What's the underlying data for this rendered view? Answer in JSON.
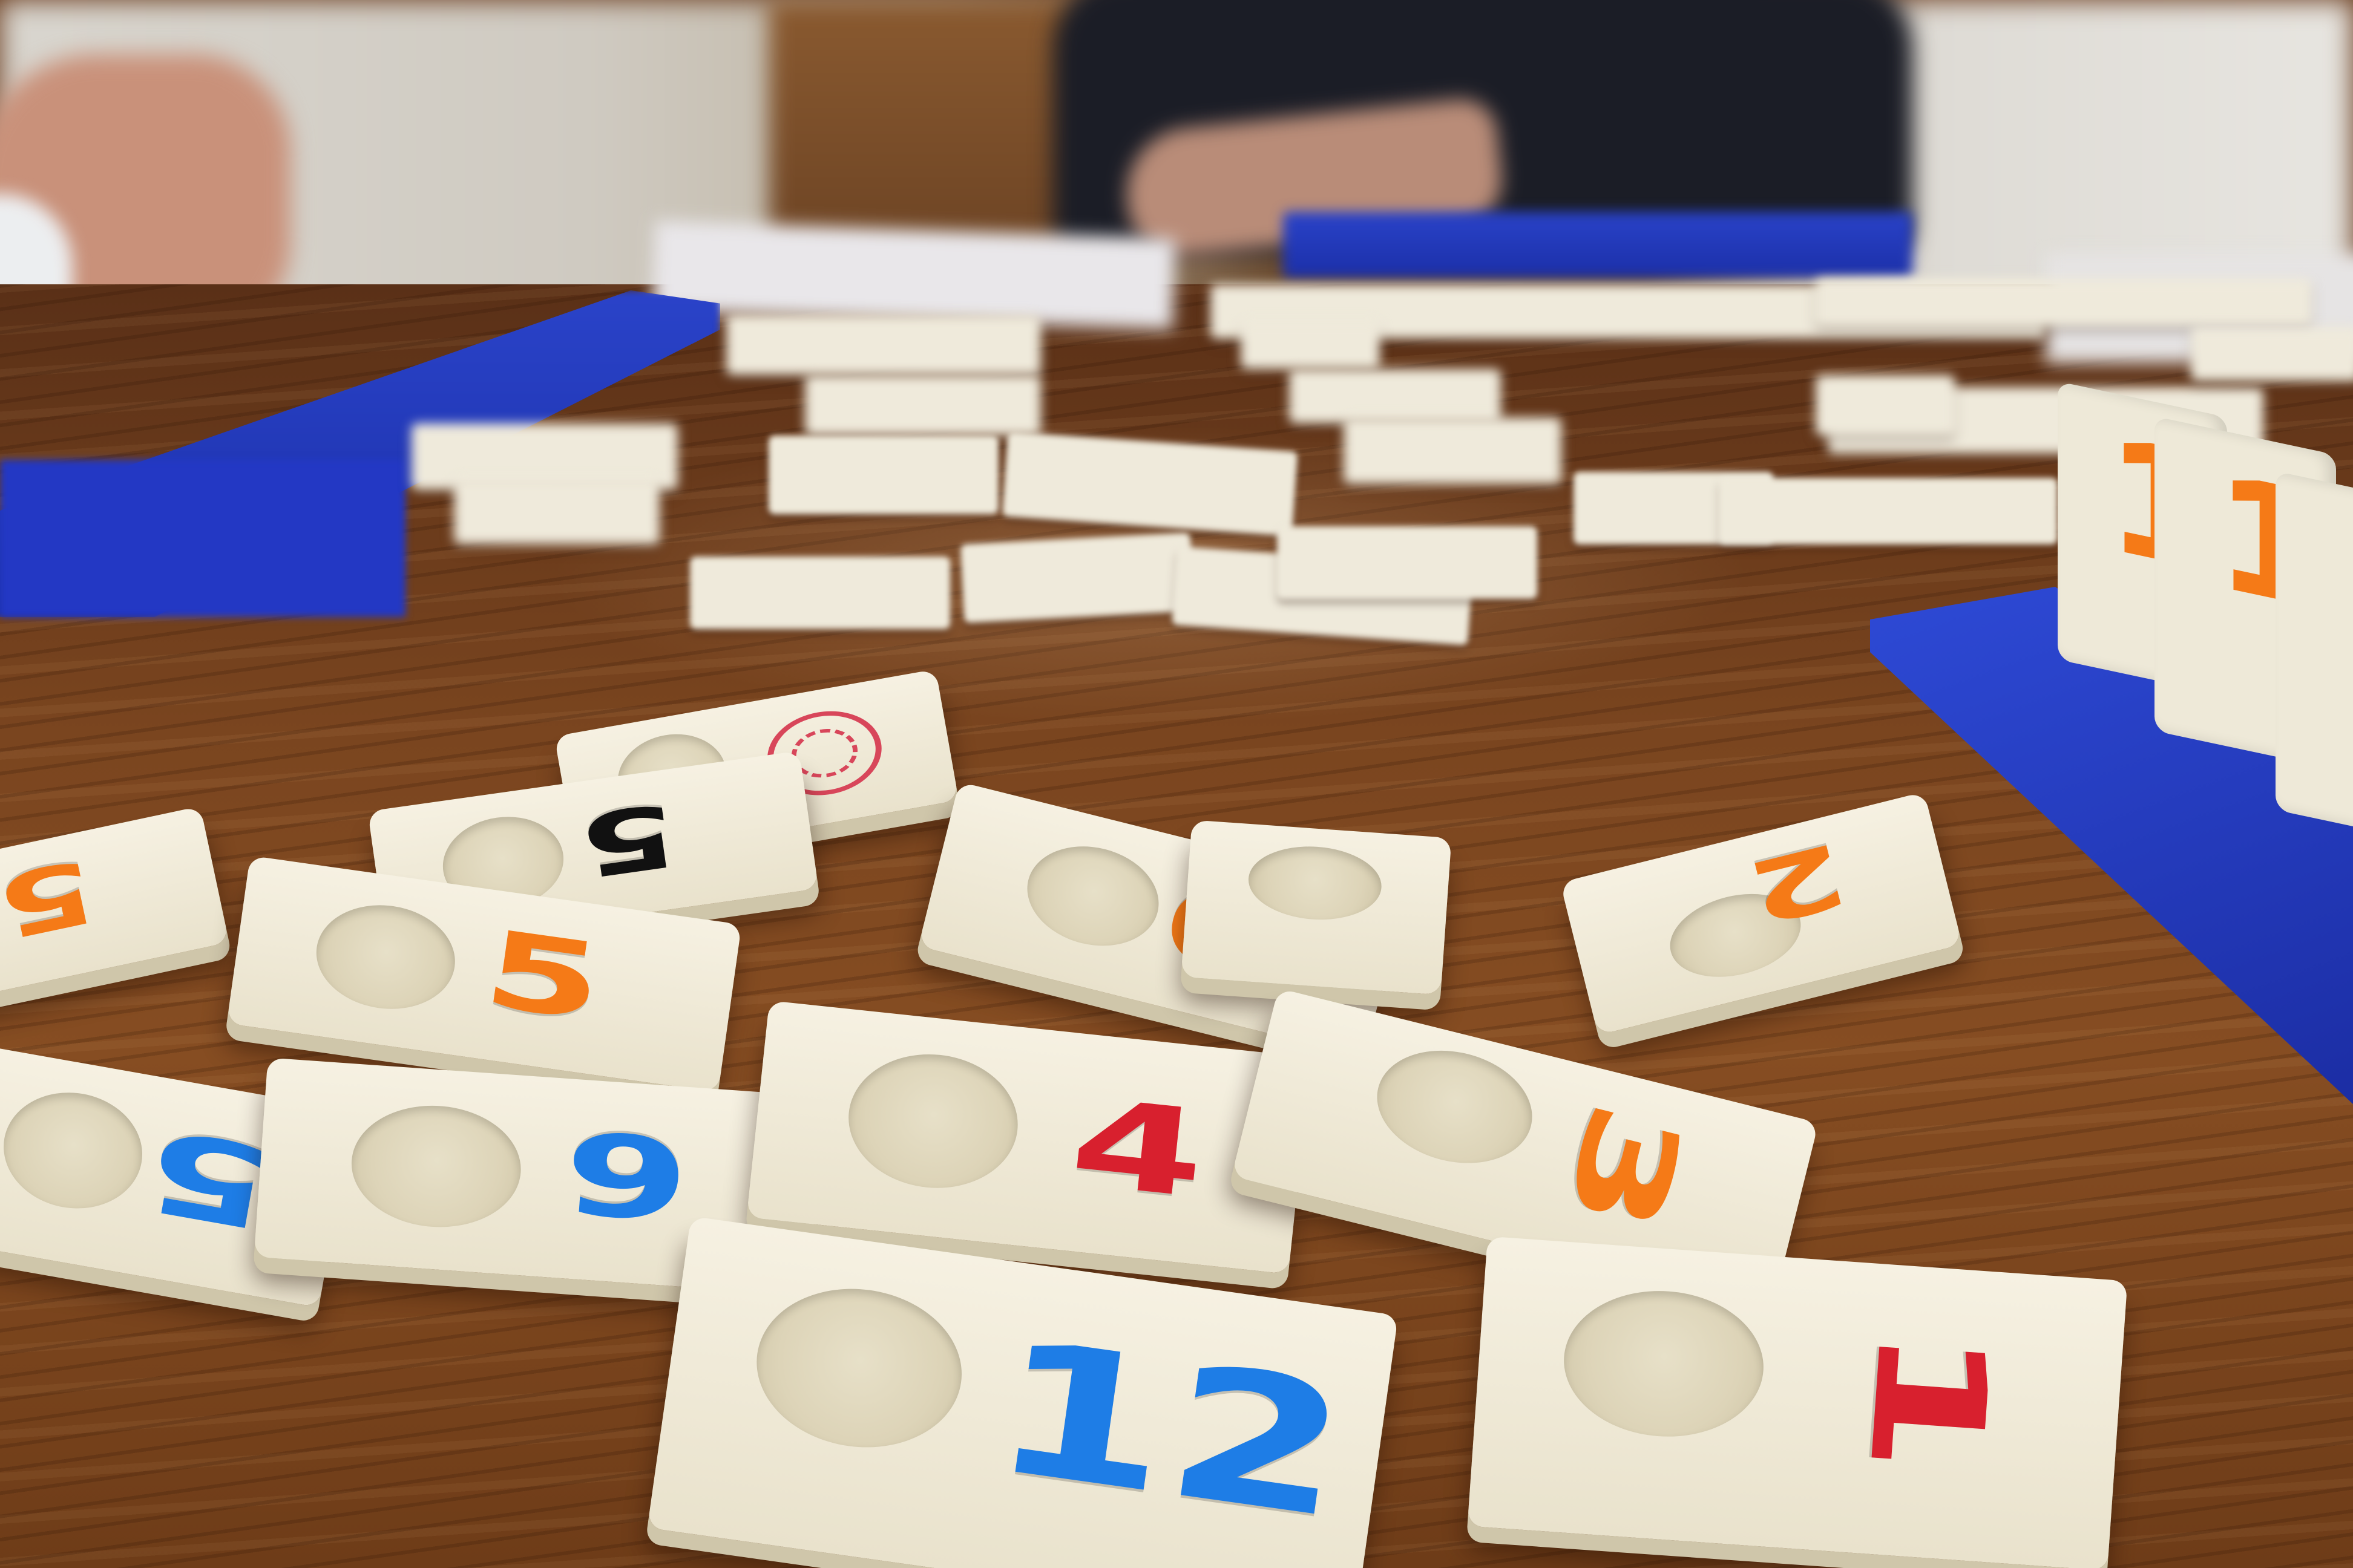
{
  "scene": "Rummikub game tiles on a wooden table",
  "colors": {
    "orange": "#f57a17",
    "blue": "#1e7de6",
    "red": "#d8202e",
    "black": "#111111",
    "rack_blue": "#2338c4"
  },
  "foreground_tiles": [
    {
      "id": "t12",
      "number": "12",
      "color": "blue"
    },
    {
      "id": "t1",
      "number": "1",
      "color": "red"
    },
    {
      "id": "t4",
      "number": "4",
      "color": "red"
    },
    {
      "id": "t3",
      "number": "3",
      "color": "orange"
    },
    {
      "id": "t9",
      "number": "9",
      "color": "orange"
    },
    {
      "id": "t2",
      "number": "2",
      "color": "orange"
    },
    {
      "id": "t6",
      "number": "6",
      "color": "blue"
    },
    {
      "id": "t5blue",
      "number": "5",
      "color": "blue"
    },
    {
      "id": "t5orange",
      "number": "5",
      "color": "orange"
    },
    {
      "id": "t5black",
      "number": "5",
      "color": "black"
    },
    {
      "id": "t5edge",
      "number": "5",
      "color": "orange"
    },
    {
      "id": "tjoker",
      "number": "",
      "color": "red"
    }
  ],
  "rack_tiles": [
    {
      "number": "1",
      "color": "orange"
    },
    {
      "number": "1",
      "color": "orange"
    }
  ]
}
